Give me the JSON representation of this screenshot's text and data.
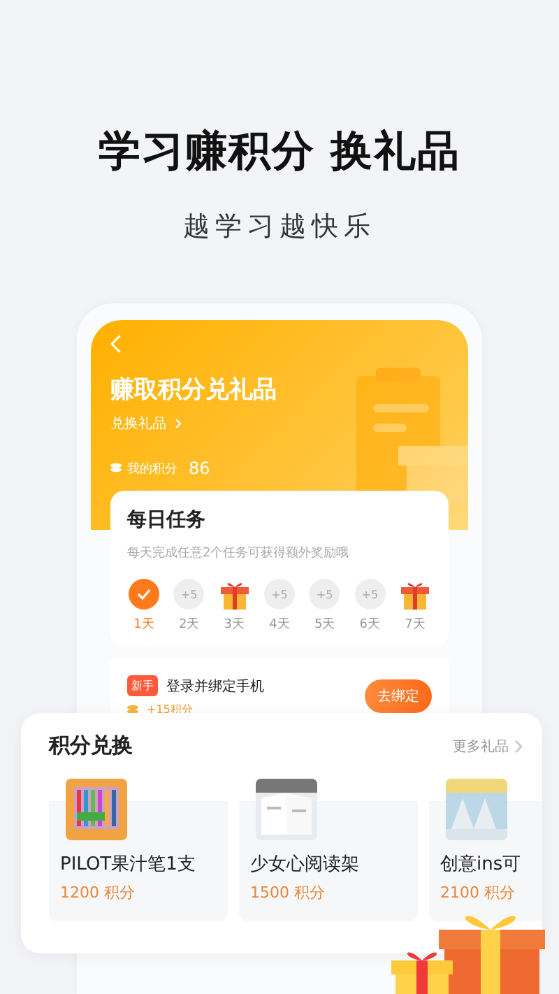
{
  "headline": "学习赚积分 换礼品",
  "subtitle": "越学习越快乐",
  "app": {
    "title": "赚取积分兑礼品",
    "link": "兑换礼品",
    "points_label": "我的积分",
    "points": "86"
  },
  "daily": {
    "title": "每日任务",
    "hint": "每天完成任意2个任务可获得额外奖励哦",
    "days": [
      {
        "kind": "done",
        "label": "1天"
      },
      {
        "kind": "points",
        "reward": "+5",
        "label": "2天"
      },
      {
        "kind": "gift",
        "label": "3天"
      },
      {
        "kind": "points",
        "reward": "+5",
        "label": "4天"
      },
      {
        "kind": "points",
        "reward": "+5",
        "label": "5天"
      },
      {
        "kind": "points",
        "reward": "+5",
        "label": "6天"
      },
      {
        "kind": "gift",
        "label": "7天"
      }
    ]
  },
  "task": {
    "tag": "新手",
    "title": "登录并绑定手机",
    "reward": "+15积分",
    "button": "去绑定"
  },
  "exchange": {
    "title": "积分兑换",
    "more": "更多礼品",
    "items": [
      {
        "name": "PILOT果汁笔1支",
        "points": "1200 积分",
        "kind": "picture"
      },
      {
        "name": "少女心阅读架",
        "points": "1500 积分",
        "kind": "picture"
      },
      {
        "name": "创意ins可",
        "points": "2100 积分",
        "kind": "picture"
      }
    ]
  }
}
